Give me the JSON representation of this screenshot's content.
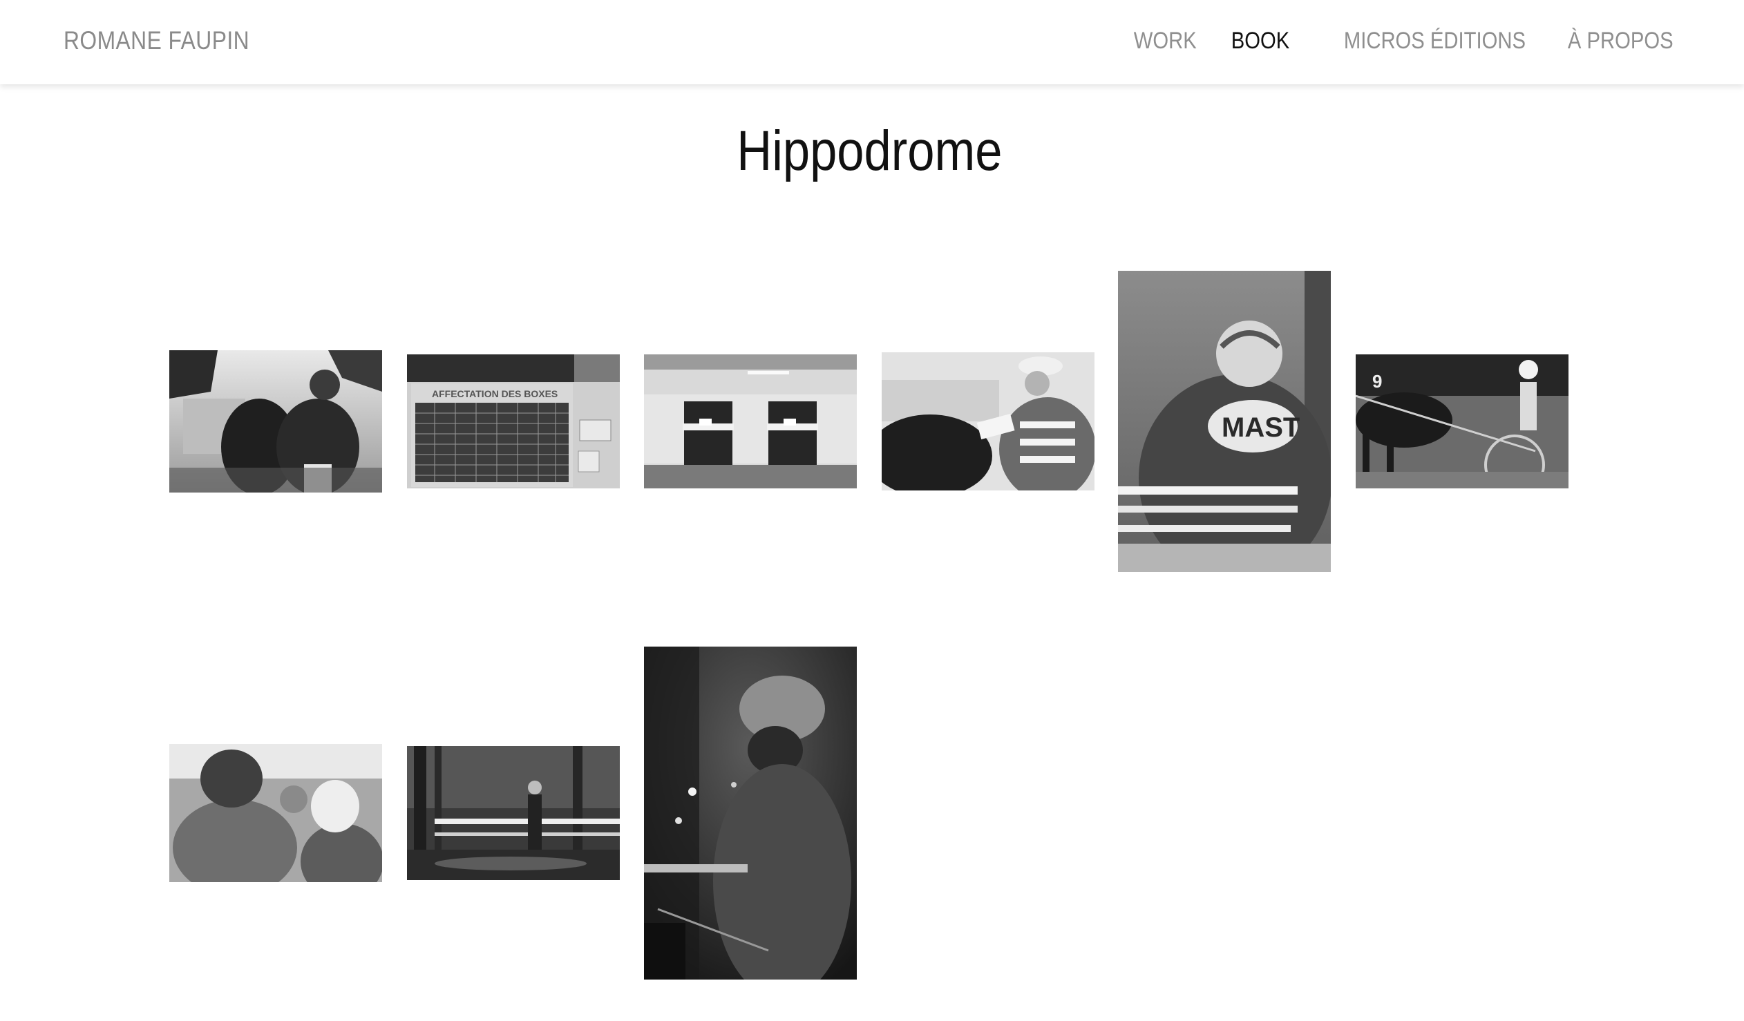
{
  "header": {
    "site_title": "ROMANE FAUPIN",
    "nav": [
      {
        "label": "WORK",
        "active": false
      },
      {
        "label": "BOOK",
        "active": true
      },
      {
        "label": "MICROS ÉDITIONS",
        "active": false
      },
      {
        "label": "À PROPOS",
        "active": false
      }
    ]
  },
  "page": {
    "title": "Hippodrome"
  },
  "gallery": {
    "photos": [
      {
        "subject": "horse-handler-photo"
      },
      {
        "subject": "boxes-board-photo",
        "sign_text": "AFFECTATION DES BOXES"
      },
      {
        "subject": "stable-doors-photo"
      },
      {
        "subject": "driver-with-program-photo"
      },
      {
        "subject": "driver-mast-jacket-photo",
        "jacket_text": "MAST"
      },
      {
        "subject": "sulky-driver-photo",
        "saddle_number": "9"
      },
      {
        "subject": "crowd-photo"
      },
      {
        "subject": "rainy-paddock-photo"
      },
      {
        "subject": "jockey-night-portrait-photo"
      }
    ]
  }
}
